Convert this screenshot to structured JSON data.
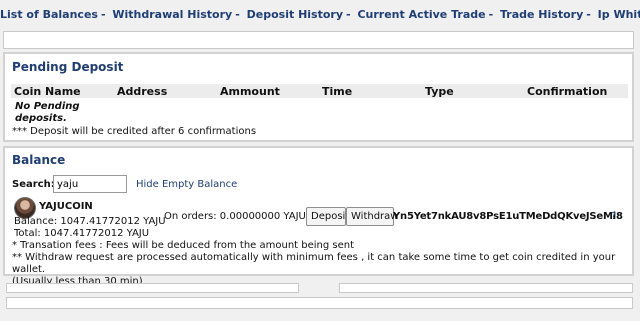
{
  "nav": [
    {
      "label": "List of Balances"
    },
    {
      "label": "Withdrawal History"
    },
    {
      "label": "Deposit History"
    },
    {
      "label": "Current Active Trade"
    },
    {
      "label": "Trade History"
    },
    {
      "label": "Ip Whitelist"
    }
  ],
  "nav_separator": "-",
  "pending": {
    "title": "Pending Deposit",
    "columns": [
      "Coin Name",
      "Address",
      "Ammount",
      "Time",
      "Type",
      "Confirmation"
    ],
    "empty_message": "No Pending deposits.",
    "note": "*** Deposit will be credited after 6 confirmations"
  },
  "balance": {
    "title": "Balance",
    "search_label": "Search:",
    "search_value": "yaju",
    "hide_empty_link": "Hide Empty Balance",
    "coin": {
      "name": "YAJUCOIN",
      "balance_text": "Balance: 1047.41772012 YAJU",
      "total_text": "Total: 1047.41772012 YAJU",
      "on_orders_text": "On orders: 0.00000000 YAJU",
      "deposit_button": "Deposit",
      "withdraw_button": "Withdraw",
      "address": "Yn5Yet7nkAU8v8PsE1uTMeDdQKveJSeMi8",
      "help_icon_text": "?",
      "avatar_icon": "coin-avatar-icon"
    },
    "notes": [
      "* Transation fees : Fees will be deduced from the amount being sent",
      "** Withdraw request are processed automatically with minimum fees , it can take some time to get coin credited in your wallet.",
      "(Usually less than 30 min)"
    ]
  },
  "colors": {
    "link_blue": "#1f3e76",
    "page_bg": "#f0f0f0",
    "panel_border": "#d2d2d2"
  }
}
